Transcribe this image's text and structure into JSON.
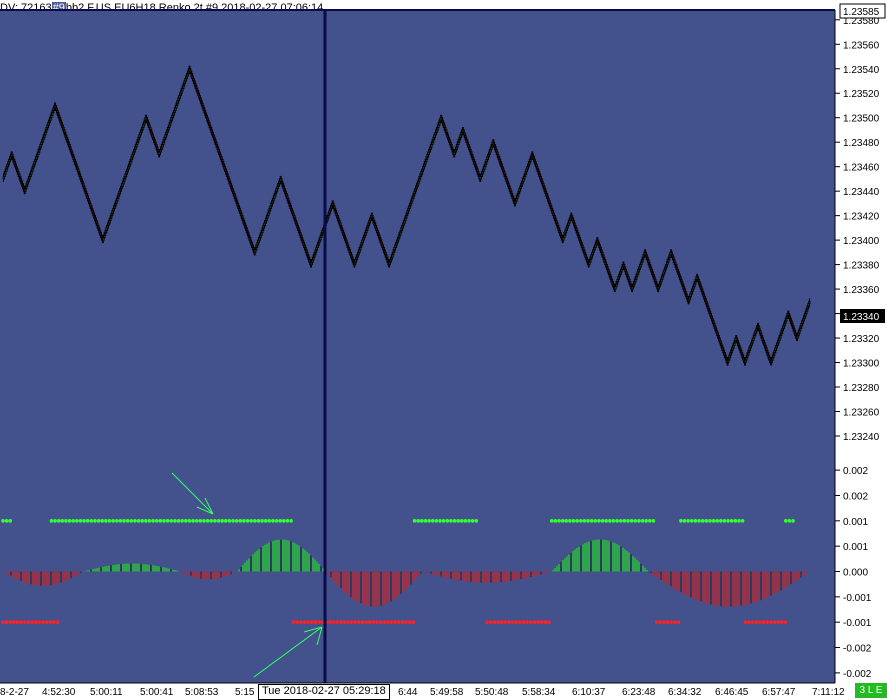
{
  "window": {
    "title_prefix": "DV: 72163",
    "title_badge": "#9",
    "title_rest": "bb2 F.US.EU6H18  Renko 2t  #9 2018-02-27 07:06:14"
  },
  "colors": {
    "background": "#43528c",
    "candle_up": "#5a8a40",
    "candle_down": "#8a2020",
    "hist_pos": "#22dd22",
    "hist_neg": "#cc2222",
    "dot_green": "#33ff33",
    "dot_red": "#ff2222",
    "crosshair": "#0a0a4a",
    "arrow": "#33ff66"
  },
  "status": {
    "label": "3 L E"
  },
  "cursor": {
    "time_label": "Tue 2018-02-27  05:29:18",
    "price_badge": "1.23585",
    "last_price": "1.23340"
  },
  "chart_data": [
    {
      "type": "candlestick",
      "name": "Renko 2t",
      "y_axis": {
        "ticks": [
          "1.23580",
          "1.23560",
          "1.23540",
          "1.23520",
          "1.23500",
          "1.23480",
          "1.23460",
          "1.23440",
          "1.23420",
          "1.23400",
          "1.23380",
          "1.23360",
          "1.23340",
          "1.23320",
          "1.23300",
          "1.23280",
          "1.23260",
          "1.23240"
        ],
        "ylim": [
          1.23222,
          1.23588
        ]
      },
      "x_axis": {
        "ticks": [
          "8-2-27",
          "4:52:30",
          "5:00:11",
          "5:00:41",
          "5:08:53",
          "5:15",
          "6:44",
          "5:49:58",
          "5:50:48",
          "5:58:34",
          "6:10:37",
          "6:23:48",
          "6:34:32",
          "6:46:45",
          "6:57:47",
          "7:11:12"
        ]
      },
      "waypoints": [
        1.2345,
        1.2347,
        1.2344,
        1.2351,
        1.2347,
        1.234,
        1.235,
        1.2347,
        1.2354,
        1.2348,
        1.2342,
        1.2339,
        1.2345,
        1.2342,
        1.2338,
        1.2343,
        1.2338,
        1.2342,
        1.2338,
        1.235,
        1.2347,
        1.2349,
        1.2345,
        1.2348,
        1.2343,
        1.2347,
        1.2342,
        1.234,
        1.2342,
        1.2338,
        1.234,
        1.2336,
        1.2338,
        1.2336,
        1.2339,
        1.2336,
        1.2339,
        1.2335,
        1.2337,
        1.2333,
        1.233,
        1.2332,
        1.233,
        1.2333,
        1.233,
        1.2334,
        1.2332,
        1.2335
      ]
    },
    {
      "type": "histogram",
      "name": "oscillator",
      "y_axis": {
        "ticks": [
          "0.002",
          "0.002",
          "0.001",
          "0.001",
          "0.000",
          "-0.001",
          "-0.001",
          "-0.002",
          "-0.002"
        ],
        "ylim": [
          -0.0022,
          0.0022
        ]
      },
      "waves": [
        {
          "from": 0,
          "to": 0.1,
          "amp": -0.45
        },
        {
          "from": 0.1,
          "to": 0.22,
          "amp": 0.25
        },
        {
          "from": 0.22,
          "to": 0.29,
          "amp": -0.25
        },
        {
          "from": 0.29,
          "to": 0.4,
          "amp": 1.0
        },
        {
          "from": 0.4,
          "to": 0.52,
          "amp": -1.1
        },
        {
          "from": 0.52,
          "to": 0.68,
          "amp": -0.35
        },
        {
          "from": 0.68,
          "to": 0.8,
          "amp": 1.0
        },
        {
          "from": 0.8,
          "to": 1.0,
          "amp": -1.1
        }
      ],
      "green_dot_segments": [
        [
          0.0,
          0.01
        ],
        [
          0.06,
          0.36
        ],
        [
          0.51,
          0.59
        ],
        [
          0.68,
          0.81
        ],
        [
          0.84,
          0.92
        ],
        [
          0.97,
          0.98
        ]
      ],
      "red_dot_segments": [
        [
          0.0,
          0.07
        ],
        [
          0.36,
          0.51
        ],
        [
          0.6,
          0.68
        ],
        [
          0.81,
          0.84
        ],
        [
          0.92,
          0.97
        ]
      ]
    }
  ]
}
